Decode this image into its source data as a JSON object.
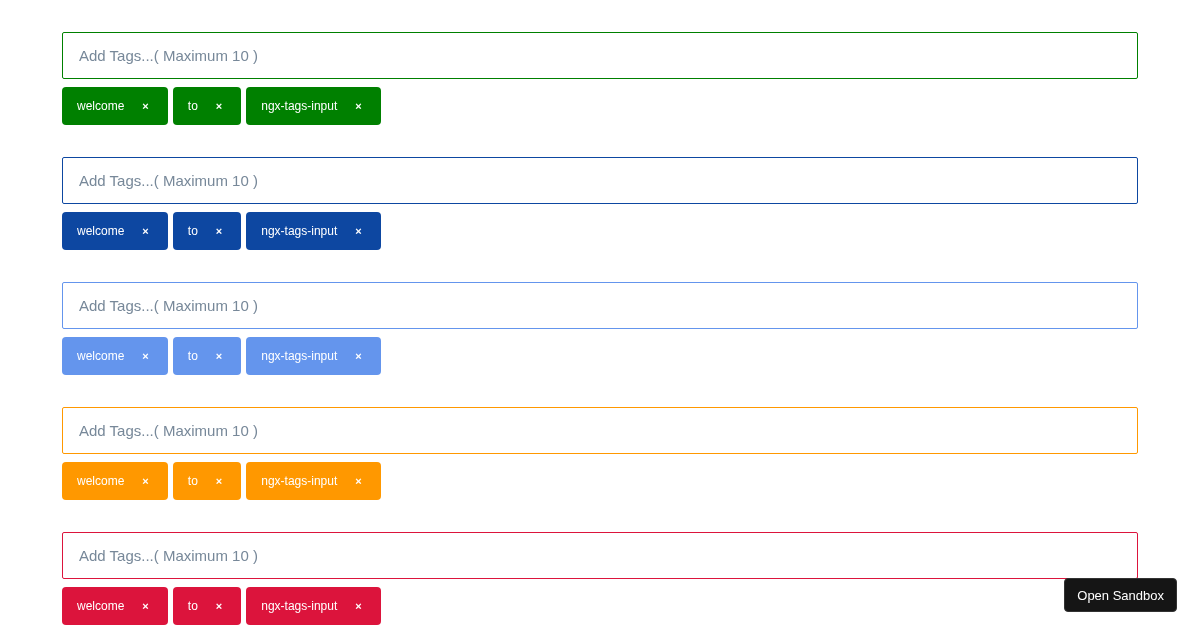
{
  "tag_inputs": [
    {
      "color": "#008000",
      "placeholder": "Add Tags...( Maximum 10 )",
      "tags": [
        {
          "label": "welcome",
          "remove": "×"
        },
        {
          "label": "to",
          "remove": "×"
        },
        {
          "label": "ngx-tags-input",
          "remove": "×"
        }
      ]
    },
    {
      "color": "#0d47a1",
      "placeholder": "Add Tags...( Maximum 10 )",
      "tags": [
        {
          "label": "welcome",
          "remove": "×"
        },
        {
          "label": "to",
          "remove": "×"
        },
        {
          "label": "ngx-tags-input",
          "remove": "×"
        }
      ]
    },
    {
      "color": "#6495ed",
      "placeholder": "Add Tags...( Maximum 10 )",
      "tags": [
        {
          "label": "welcome",
          "remove": "×"
        },
        {
          "label": "to",
          "remove": "×"
        },
        {
          "label": "ngx-tags-input",
          "remove": "×"
        }
      ]
    },
    {
      "color": "#ff9800",
      "placeholder": "Add Tags...( Maximum 10 )",
      "tags": [
        {
          "label": "welcome",
          "remove": "×"
        },
        {
          "label": "to",
          "remove": "×"
        },
        {
          "label": "ngx-tags-input",
          "remove": "×"
        }
      ]
    },
    {
      "color": "#dc143c",
      "placeholder": "Add Tags...( Maximum 10 )",
      "tags": [
        {
          "label": "welcome",
          "remove": "×"
        },
        {
          "label": "to",
          "remove": "×"
        },
        {
          "label": "ngx-tags-input",
          "remove": "×"
        }
      ]
    }
  ],
  "sandbox_button": "Open Sandbox"
}
